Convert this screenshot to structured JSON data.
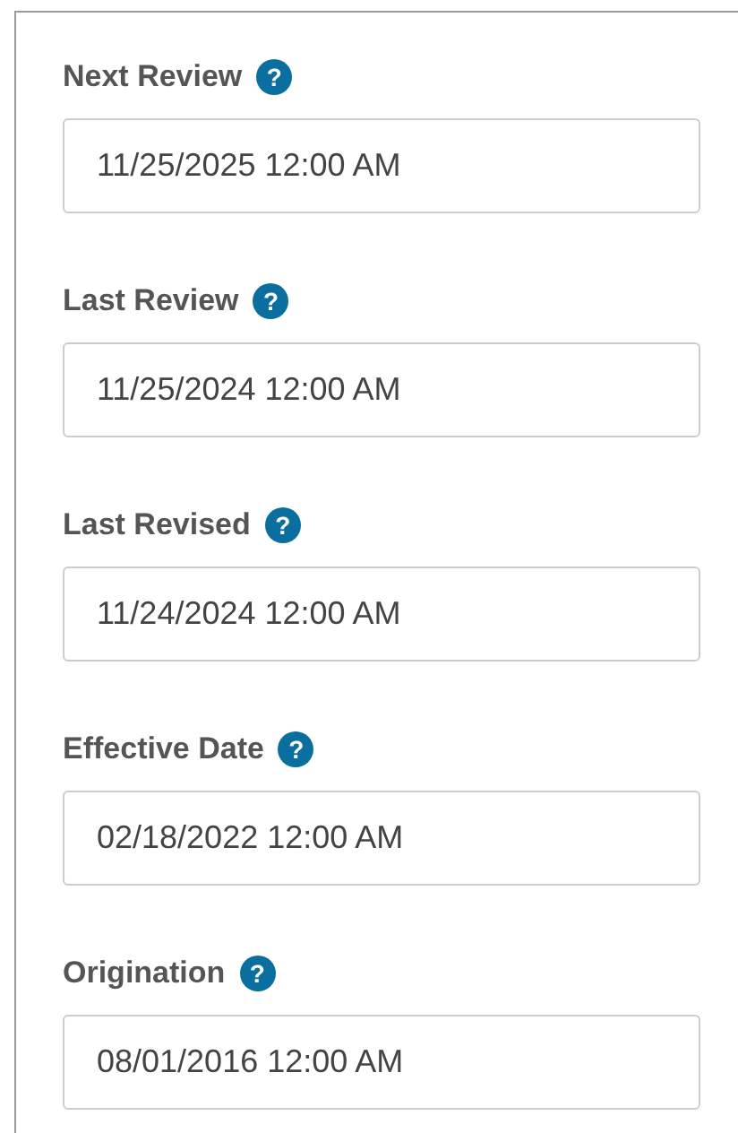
{
  "fields": [
    {
      "label": "Next Review",
      "help": "?",
      "value": "11/25/2025 12:00 AM"
    },
    {
      "label": "Last Review",
      "help": "?",
      "value": "11/25/2024 12:00 AM"
    },
    {
      "label": "Last Revised",
      "help": "?",
      "value": "11/24/2024 12:00 AM"
    },
    {
      "label": "Effective Date",
      "help": "?",
      "value": "02/18/2022 12:00 AM"
    },
    {
      "label": "Origination",
      "help": "?",
      "value": "08/01/2016 12:00 AM"
    }
  ]
}
